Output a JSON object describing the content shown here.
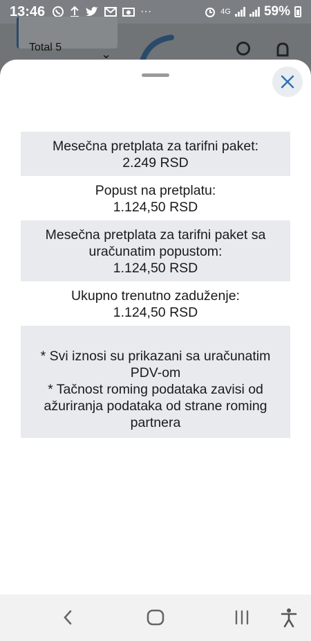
{
  "status_bar": {
    "time": "13:46",
    "network": "4G",
    "battery": "59%"
  },
  "background_app": {
    "total_label": "Total 5"
  },
  "sheet": {
    "rows": [
      {
        "label": "Mesečna pretplata za tarifni paket:",
        "value": "2.249 RSD"
      },
      {
        "label": "Popust na pretplatu:",
        "value": "1.124,50 RSD"
      },
      {
        "label_line1": "Mesečna pretplata za tarifni paket sa",
        "label_line2": "uračunatim popustom:",
        "value": "1.124,50 RSD"
      },
      {
        "label": "Ukupno trenutno zaduženje:",
        "value": "1.124,50 RSD"
      }
    ],
    "notes": {
      "line1": "* Svi iznosi su prikazani sa uračunatim",
      "line2": "PDV-om",
      "line3": "* Tačnost roming podataka zavisi od",
      "line4": "ažuriranja podataka od strane roming",
      "line5": "partnera"
    }
  },
  "icons": {
    "close": "close-icon",
    "back": "back-icon",
    "home": "home-icon",
    "recents": "recents-icon",
    "accessibility": "accessibility-icon"
  },
  "colors": {
    "accent": "#2f6fb0",
    "row_shade": "#e8eaee",
    "close_bg": "#e9edf1"
  }
}
